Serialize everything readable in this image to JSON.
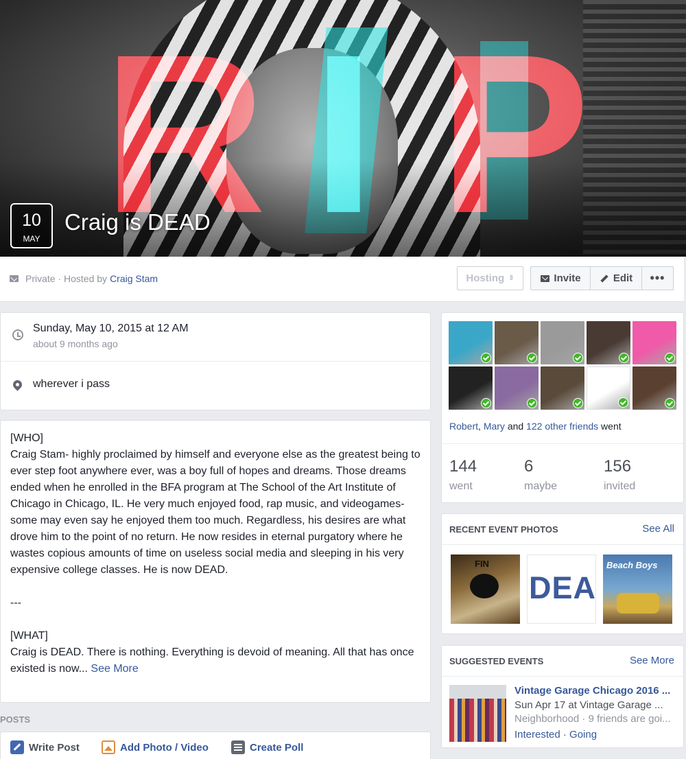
{
  "event": {
    "day": "10",
    "month": "MAY",
    "title": "Craig is DEAD",
    "cover_text": "RIP"
  },
  "header": {
    "privacy_prefix": "Private · Hosted by",
    "host_name": "Craig Stam",
    "hosting_label": "Hosting",
    "invite_label": "Invite",
    "edit_label": "Edit",
    "more_label": "•••"
  },
  "info": {
    "when_main": "Sunday, May 10, 2015 at 12 AM",
    "when_sub": "about 9 months ago",
    "where": "wherever i pass"
  },
  "description": {
    "p1": "[WHO]\nCraig Stam- highly proclaimed by himself and everyone else as the greatest being to ever step foot anywhere ever, was a boy full of hopes and dreams. Those dreams ended when he enrolled in the BFA program at The School of the Art Institute of Chicago in Chicago, IL. He very much enjoyed food, rap music, and videogames- some may even say he enjoyed them too much. Regardless, his desires are what drove him to the point of no return. He now resides in eternal purgatory where he wastes copious amounts of time on useless social media and sleeping in his very expensive college classes. He is now DEAD.",
    "p2": "---",
    "p3": "[WHAT]\nCraig is DEAD. There is nothing. Everything is devoid of meaning. All that has once existed is now...",
    "see_more": "See More"
  },
  "posts": {
    "section_label": "POSTS",
    "write_post": "Write Post",
    "add_photo": "Add Photo / Video",
    "create_poll": "Create Poll"
  },
  "guests": {
    "friend1": "Robert",
    "friend2": "Mary",
    "and_text": "and",
    "others": "122 other friends",
    "went_text": "went",
    "went_count": "144",
    "went_label": "went",
    "maybe_count": "6",
    "maybe_label": "maybe",
    "invited_count": "156",
    "invited_label": "invited",
    "avatar_colors": [
      "#3aa7c8",
      "#6a5a48",
      "#9a9a9a",
      "#4a3a34",
      "#f05aa8",
      "#222222",
      "#8a6aa0",
      "#5a4a3a",
      "#ffffff",
      "#5a4030"
    ]
  },
  "photos": {
    "heading": "RECENT EVENT PHOTOS",
    "see_all": "See All",
    "photo1_text": "FIN",
    "photo2_text": "DEAI",
    "photo3_text": "Beach Boys"
  },
  "suggested": {
    "heading": "SUGGESTED EVENTS",
    "see_more": "See More",
    "title": "Vintage Garage Chicago 2016 ...",
    "when_where": "Sun Apr 17 at Vintage Garage ...",
    "meta": "Neighborhood · 9 friends are goi...",
    "actions": "Interested · Going"
  }
}
